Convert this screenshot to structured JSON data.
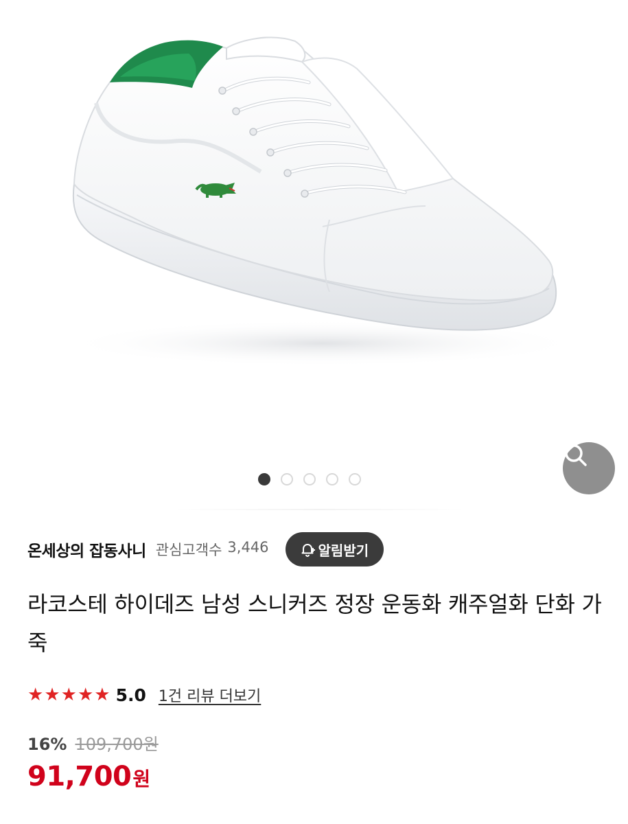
{
  "gallery": {
    "total_images": 5,
    "active_index": 0,
    "zoom_icon": "search-icon",
    "product_image": "white-sneaker-green-heel-photo"
  },
  "seller": {
    "name": "온세상의 잡동사니",
    "followers_label": "관심고객수",
    "followers_count": "3,446",
    "alert_label": "알림받기",
    "alert_icon": "bell-plus-icon"
  },
  "product": {
    "title": "라코스테 하이데즈 남성 스니커즈 정장 운동화 캐주얼화 단화 가죽"
  },
  "rating": {
    "stars": 5,
    "score": "5.0",
    "review_link": "1건 리뷰 더보기"
  },
  "price": {
    "discount_rate": "16%",
    "original": "109,700원",
    "current": "91,700",
    "unit": "원"
  },
  "colors": {
    "star": "#e02424",
    "price": "#d0021b",
    "alert_button_bg": "#3b3b3b",
    "zoom_button_bg": "#8f8f8f"
  }
}
